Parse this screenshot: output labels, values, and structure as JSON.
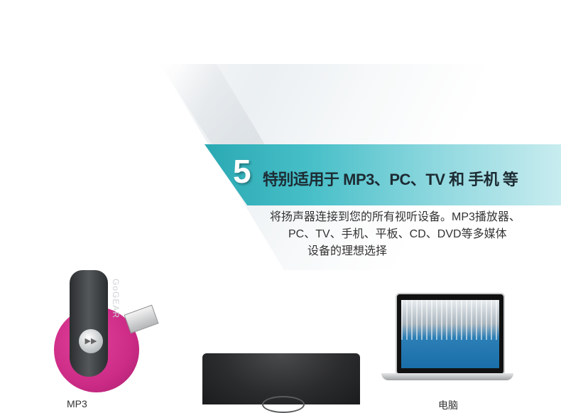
{
  "feature": {
    "number": "5",
    "title": "特别适用于 MP3、PC、TV 和 手机 等",
    "description_lines": [
      "将扬声器连接到您的所有视听设备。MP3播放器、",
      "PC、TV、手机、平板、CD、DVD等多媒体",
      "设备的理想选择"
    ],
    "colors": {
      "band_start": "#2aa9b3",
      "band_end": "#c8ecef"
    }
  },
  "devices": {
    "mp3": {
      "brand": "GoGEAR",
      "label": "MP3",
      "icon": "mp3-player-icon",
      "accent": "#cc2b86"
    },
    "speaker": {
      "icon": "speaker-icon"
    },
    "laptop": {
      "label": "电脑",
      "icon": "laptop-icon"
    }
  }
}
